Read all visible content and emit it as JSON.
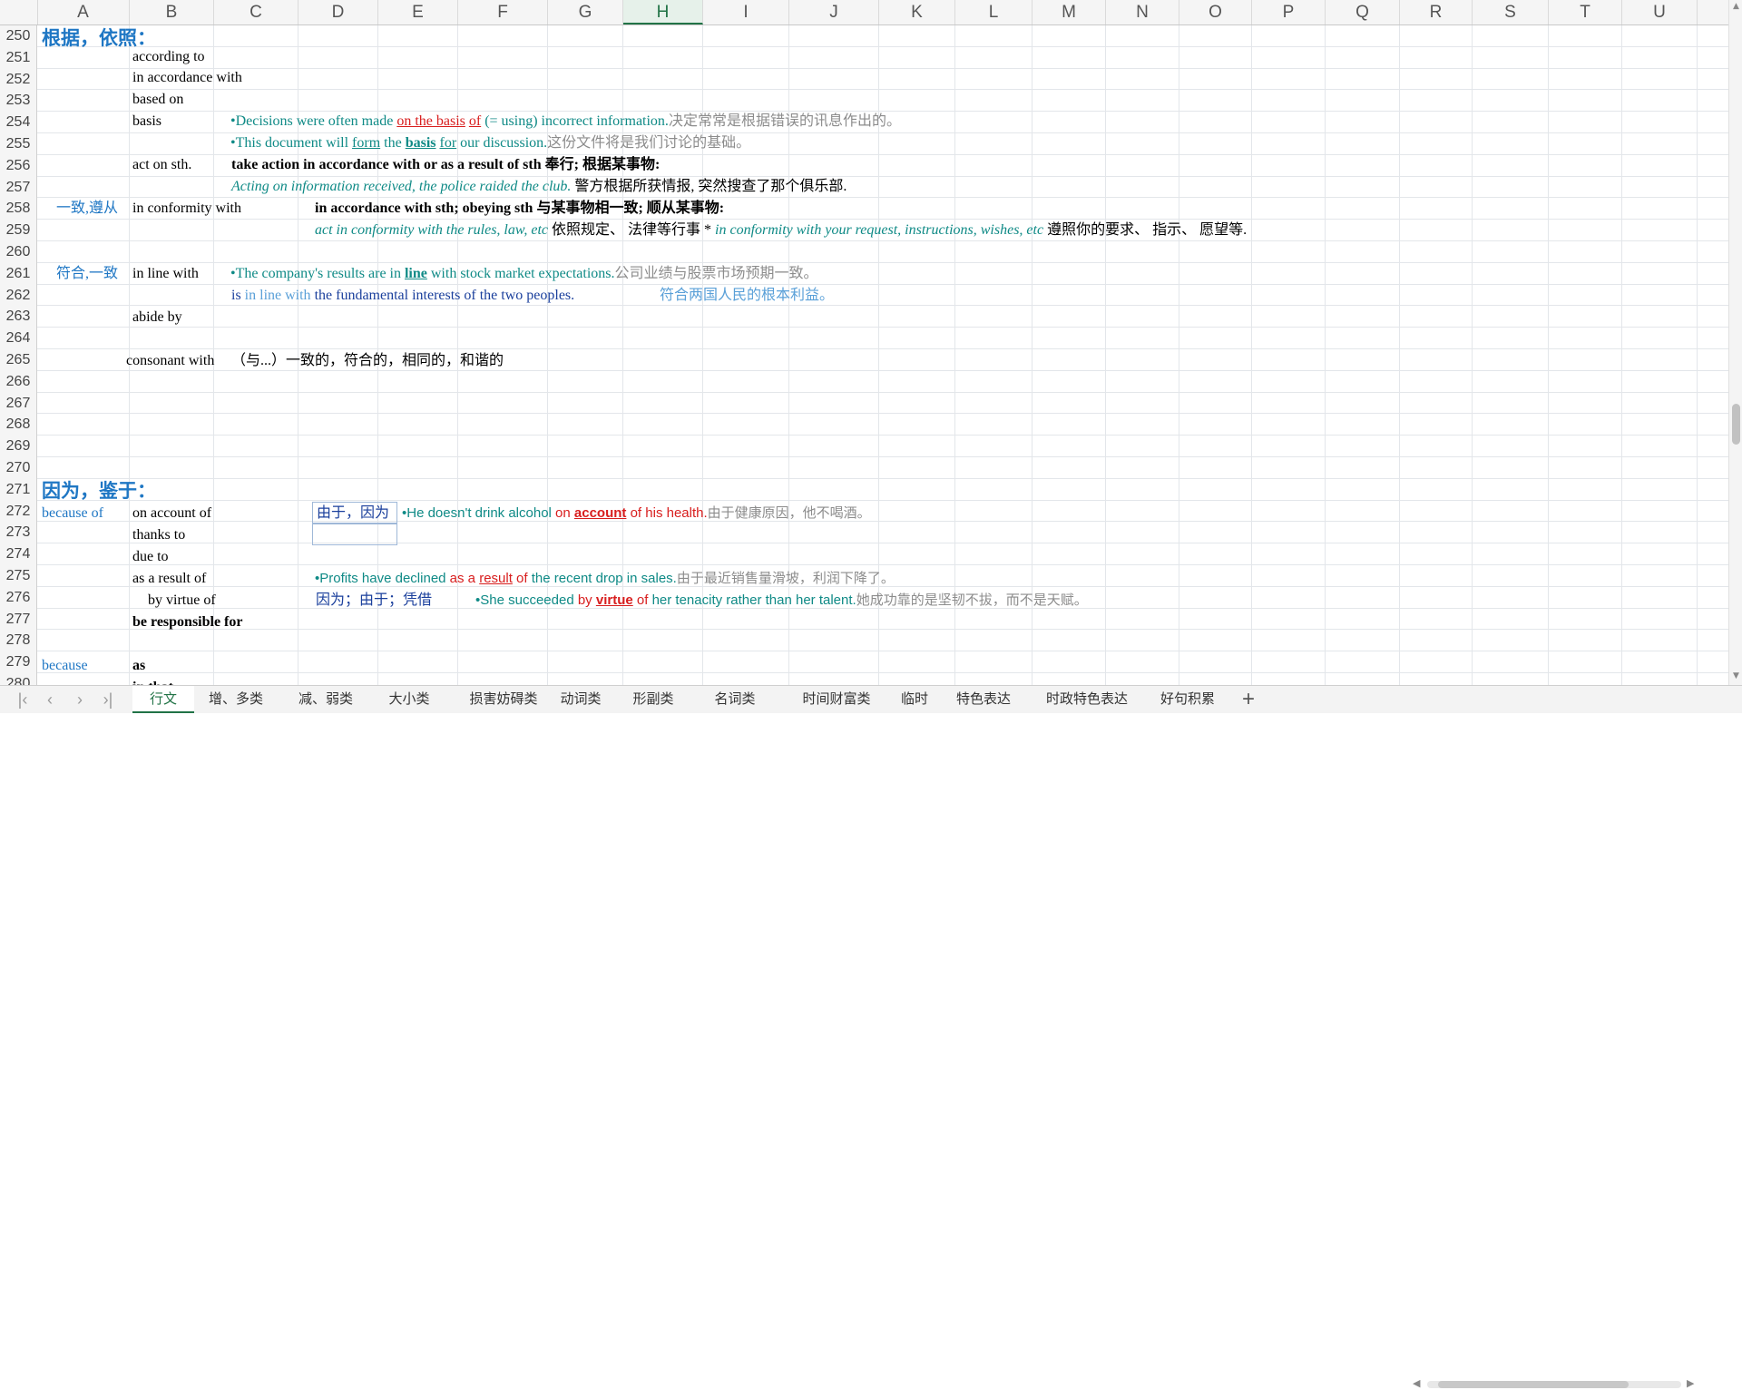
{
  "columns": [
    "A",
    "B",
    "C",
    "D",
    "E",
    "F",
    "G",
    "H",
    "I",
    "J",
    "K",
    "L",
    "M",
    "N",
    "O",
    "P",
    "Q",
    "R",
    "S",
    "T",
    "U"
  ],
  "selected_column": "H",
  "rows": [
    "250",
    "251",
    "252",
    "253",
    "254",
    "255",
    "256",
    "257",
    "258",
    "259",
    "260",
    "261",
    "262",
    "263",
    "264",
    "265",
    "266",
    "267",
    "268",
    "269",
    "270",
    "271",
    "272",
    "273",
    "274",
    "275",
    "276",
    "277",
    "278",
    "279",
    "280"
  ],
  "cells": {
    "r250_a": "根据，依照：",
    "r251_b": "according to",
    "r252_b": "in accordance with",
    "r253_b": "based on",
    "r254_b": "basis",
    "r254_c": [
      "•Decisions were often made ",
      "on the basis",
      " ",
      "of",
      " (= using) incorrect information.",
      "决定常常是根据错误的讯息作出的。"
    ],
    "r255_c": [
      "•This document will ",
      "form",
      " the ",
      "basis",
      " ",
      "for",
      " our discussion.",
      "这份文件将是我们讨论的基础。"
    ],
    "r256_b": "act on sth.",
    "r256_c": "take action in accordance with or as a result of sth 奉行; 根据某事物:",
    "r257_c": [
      "Acting on information received, the police raided the club.",
      " 警方根据所获情报, 突然搜查了那个俱乐部."
    ],
    "r258_a": "一致,遵从",
    "r258_b": "in conformity with",
    "r258_d": "in accordance with sth; obeying sth 与某事物相一致; 顺从某事物:",
    "r259_d": [
      "act in conformity with the rules, law, etc",
      " 依照规定、 法律等行事 * ",
      "in conformity with your request, instructions, wishes, etc",
      " 遵照你的要求、 指示、 愿望等."
    ],
    "r261_a": "符合,一致",
    "r261_b": "in line with",
    "r261_c": [
      "•The company's results are in ",
      "line",
      " with stock market expectations.",
      "公司业绩与股票市场预期一致。"
    ],
    "r262_c": [
      "is ",
      "in line with",
      " the fundamental interests of the two peoples.",
      "符合两国人民的根本利益。"
    ],
    "r263_b": "abide by",
    "r265_b": "consonant with",
    "r265_c": "（与...）一致的，符合的，相同的，和谐的",
    "r271_a": "因为，鉴于：",
    "r272_a": "because of",
    "r272_b": "on account of",
    "r272_d": "由于，因为",
    "r272_e": [
      "•He doesn't drink alcohol ",
      "on ",
      "account",
      " of his health.",
      "由于健康原因，他不喝酒。"
    ],
    "r273_b": "thanks to",
    "r274_b": "due to",
    "r275_b": "as a result of",
    "r275_d": [
      "•Profits have declined ",
      "as a ",
      "result",
      " of",
      " the recent drop in sales.",
      "由于最近销售量滑坡，利润下降了。"
    ],
    "r276_b": "by virtue of",
    "r276_d": "因为；由于；凭借",
    "r276_e": [
      "•She succeeded ",
      "by ",
      "virtue",
      " of",
      " her tenacity rather than her talent.",
      "她成功靠的是坚韧不拔，而不是天赋。"
    ],
    "r277_b": "be responsible for",
    "r279_a": "because",
    "r279_b": "as",
    "r280_b": "in that"
  },
  "sheet_tabs": [
    "行文",
    "增、多类",
    "减、弱类",
    "大小类",
    "损害妨碍类",
    "动词类",
    "形副类",
    "名词类",
    "时间财富类",
    "临时",
    "特色表达",
    "时政特色表达",
    "好句积累"
  ],
  "active_tab": "行文",
  "nav_icons": [
    "first-sheet-icon",
    "prev-sheet-icon",
    "next-sheet-icon",
    "last-sheet-icon"
  ],
  "add_sheet_symbol": "+",
  "colors": {
    "accent": "#217346",
    "heading_blue": "#1f77c4",
    "teal": "#0f8a86",
    "red": "#d81e1e",
    "gray": "#8c8c8c"
  }
}
